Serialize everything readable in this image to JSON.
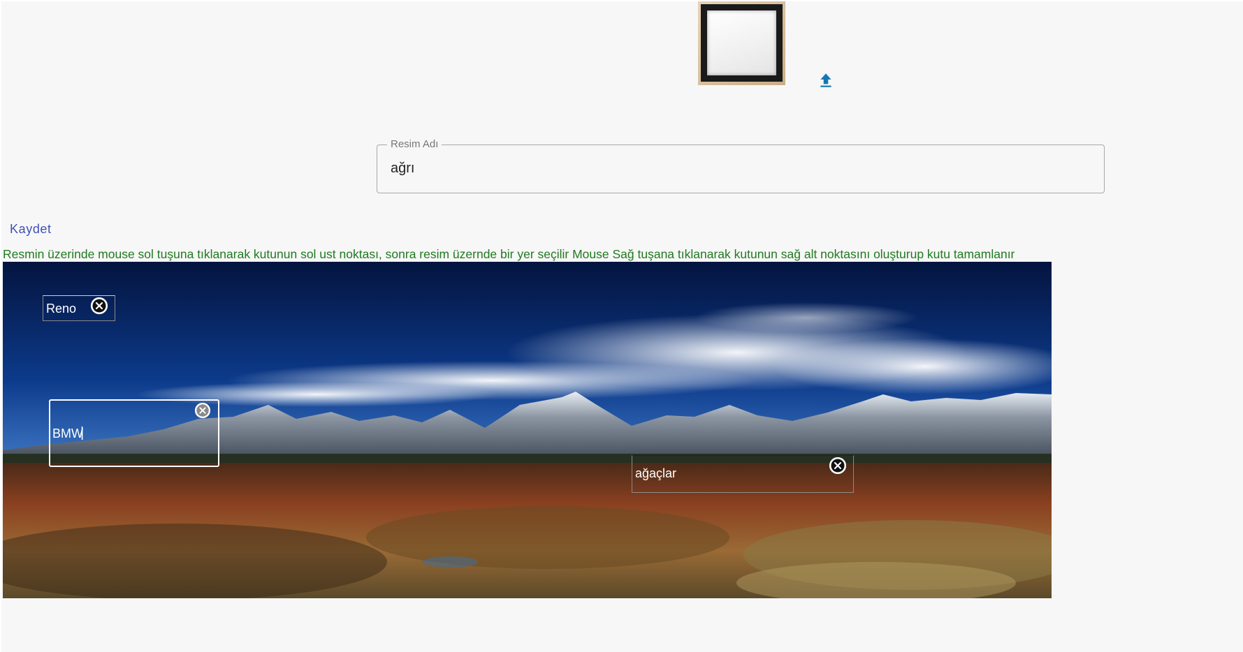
{
  "image_name_field": {
    "label": "Resim Adı",
    "value": "ağrı"
  },
  "save_label": "Kaydet",
  "instruction": "Resmin üzerinde mouse sol tuşuna tıklanarak kutunun sol ust noktası, sonra resim üzernde bir yer seçilir Mouse Sağ tuşana tıklanarak kutunun sağ alt noktasını oluşturup kutu tamamlanır",
  "annotations": [
    {
      "label": "Reno"
    },
    {
      "label": "BMW"
    },
    {
      "label": "ağaçlar"
    }
  ],
  "icons": {
    "upload": "upload-arrow-icon",
    "remove": "close-circle-icon"
  },
  "colors": {
    "save": "#3f51b5",
    "instruction": "#1f7a1f",
    "upload": "#1677b3"
  }
}
